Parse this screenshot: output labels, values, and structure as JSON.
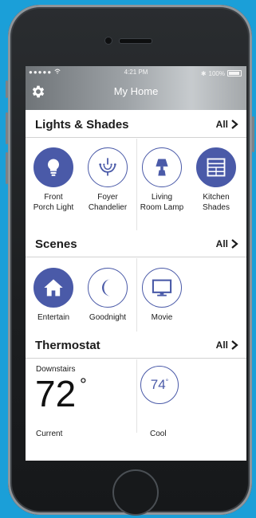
{
  "status": {
    "carrier": "●●●●● ",
    "time": "4:21 PM",
    "battery": "100%"
  },
  "header": {
    "title": "My Home"
  },
  "lights": {
    "title": "Lights & Shades",
    "all_label": "All",
    "items": [
      {
        "line1": "Front",
        "line2": "Porch Light",
        "icon": "lightbulb-icon",
        "on": true
      },
      {
        "line1": "Foyer",
        "line2": "Chandelier",
        "icon": "chandelier-icon",
        "on": false
      },
      {
        "line1": "Living",
        "line2": "Room Lamp",
        "icon": "lamp-icon",
        "on": false
      },
      {
        "line1": "Kitchen",
        "line2": "Shades",
        "icon": "shades-icon",
        "on": true
      }
    ]
  },
  "scenes": {
    "title": "Scenes",
    "all_label": "All",
    "items": [
      {
        "label": "Entertain",
        "icon": "house-icon",
        "on": true
      },
      {
        "label": "Goodnight",
        "icon": "moon-icon",
        "on": false
      },
      {
        "label": "Movie",
        "icon": "tv-icon",
        "on": false
      }
    ]
  },
  "thermostat": {
    "title": "Thermostat",
    "all_label": "All",
    "zone": "Downstairs",
    "current_temp": "72",
    "degree": "°",
    "current_label": "Current",
    "setpoint": "74",
    "mode_label": "Cool"
  },
  "colors": {
    "accent": "#4a5aa8",
    "background": "#1b9fd8"
  }
}
